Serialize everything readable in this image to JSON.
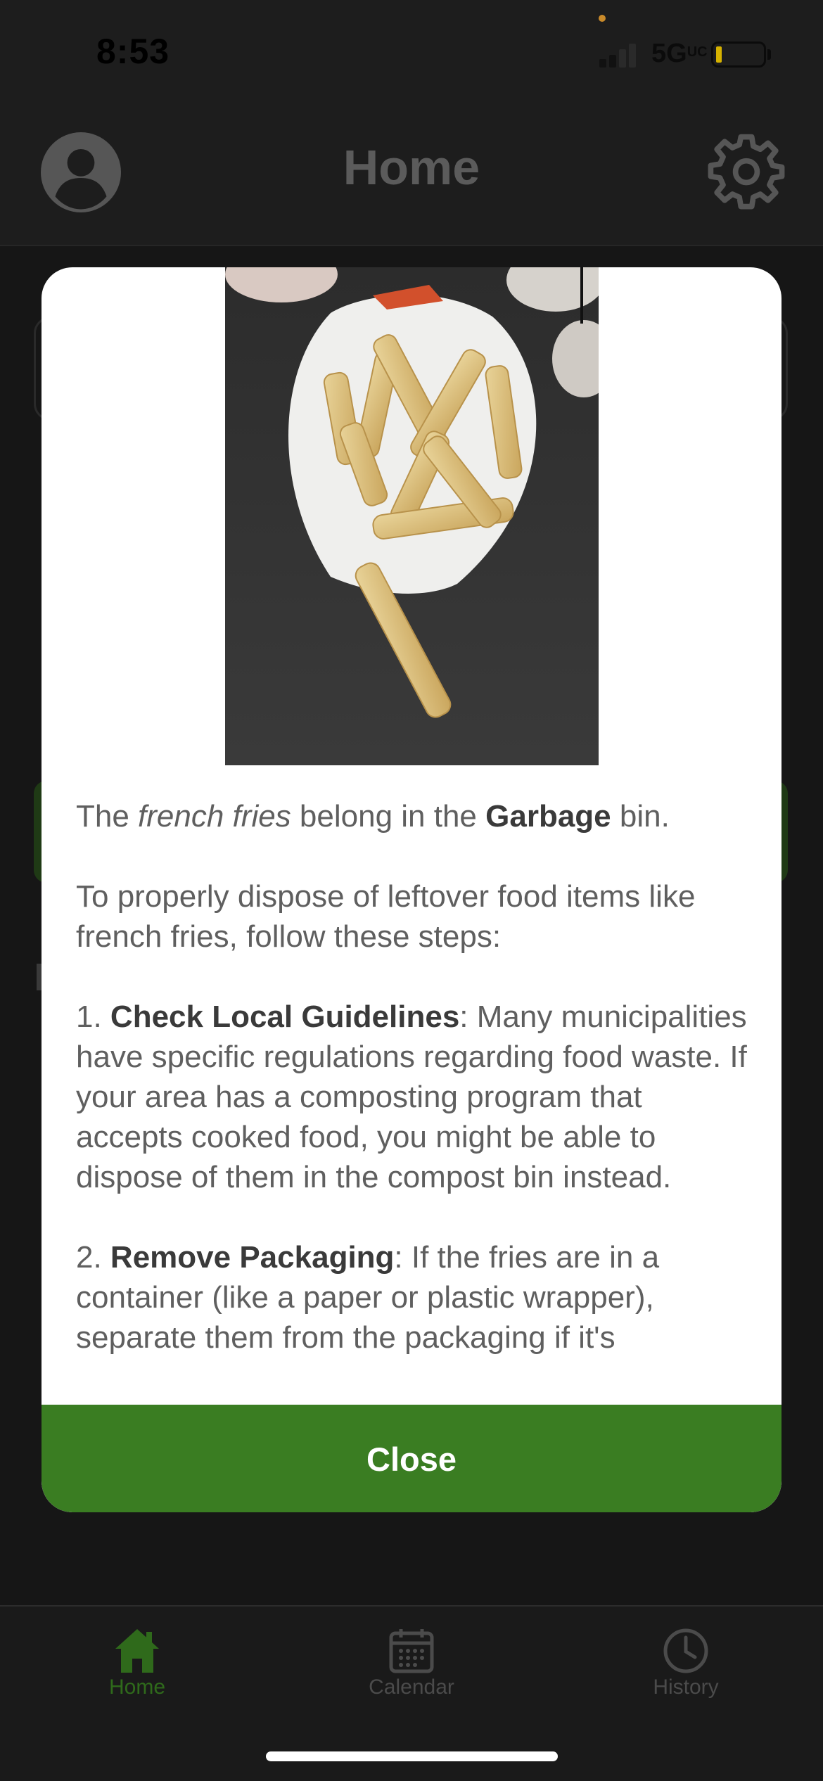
{
  "status_bar": {
    "time": "8:53",
    "network": "5G",
    "network_suffix": "UC",
    "battery_color": "#d6b200"
  },
  "header": {
    "title": "Home",
    "profile_icon": "person-circle-icon",
    "settings_icon": "gear-icon"
  },
  "modal": {
    "photo_alt": "french fries",
    "paragraph1": {
      "pre": "The ",
      "item": "french fries",
      "mid": " belong in the ",
      "bin": "Garbage",
      "post": " bin."
    },
    "paragraph2": "To properly dispose of leftover food items like french fries, follow these steps:",
    "step1": {
      "number": "1. ",
      "title": "Check Local Guidelines",
      "text": ": Many municipalities have specific regulations regarding food waste. If your area has a composting program that accepts cooked food, you might be able to dispose of them in the compost bin instead."
    },
    "step2": {
      "number": "2. ",
      "title": "Remove Packaging",
      "text": ": If the fries are in a container (like a paper or plastic wrapper), separate them from the packaging if it's"
    },
    "close_label": "Close",
    "accent_color": "#3a7d22"
  },
  "tab_bar": {
    "tabs": [
      {
        "label": "Home",
        "icon": "house-icon",
        "active": true
      },
      {
        "label": "Calendar",
        "icon": "calendar-icon",
        "active": false
      },
      {
        "label": "History",
        "icon": "clock-icon",
        "active": false
      }
    ]
  }
}
